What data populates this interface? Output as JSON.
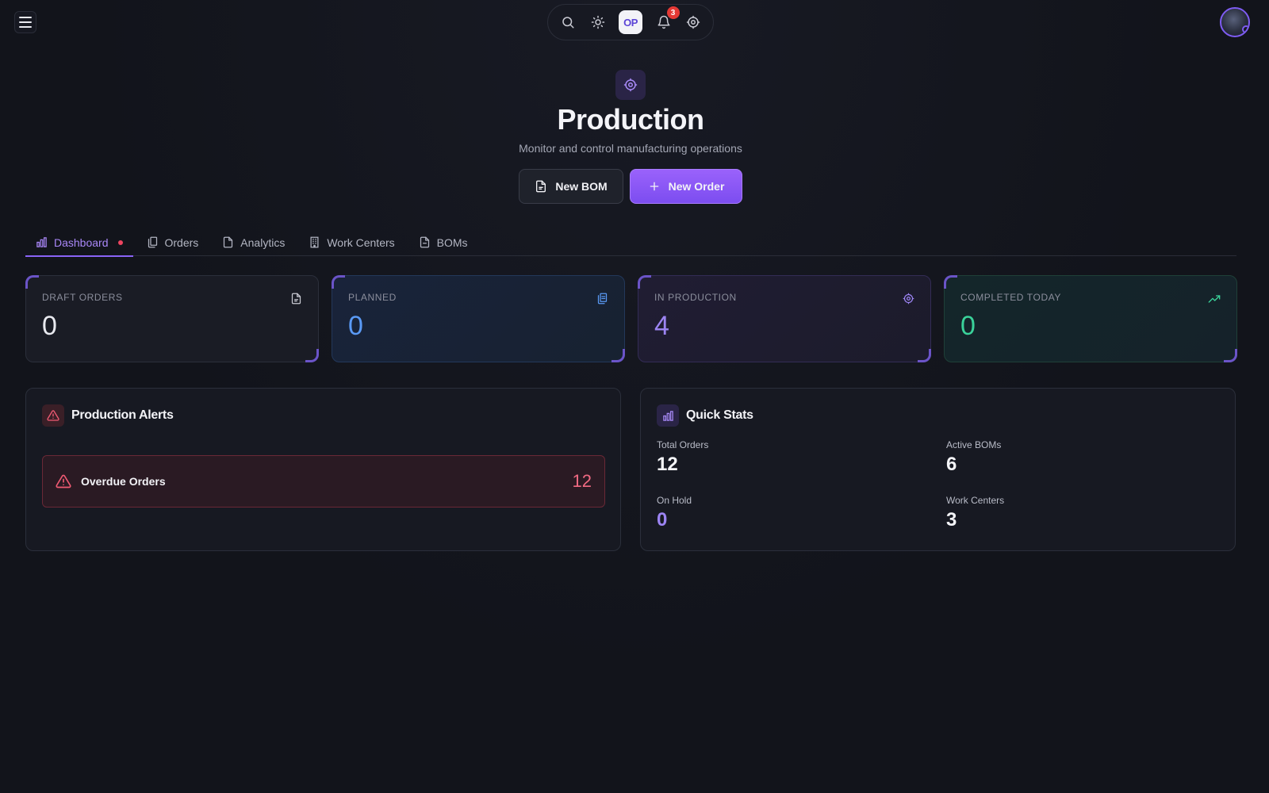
{
  "toolbar": {
    "logo_text": "OP",
    "notification_count": "3",
    "icons": [
      "search-icon",
      "sun-icon",
      "bell-icon",
      "gear-icon"
    ]
  },
  "header": {
    "title": "Production",
    "subtitle": "Monitor and control manufacturing operations",
    "new_bom_label": "New BOM",
    "new_order_label": "New Order"
  },
  "tabs": [
    {
      "label": "Dashboard",
      "active": true,
      "icon": "bar-chart-icon"
    },
    {
      "label": "Orders",
      "icon": "clipboard-icon"
    },
    {
      "label": "Analytics",
      "icon": "file-icon"
    },
    {
      "label": "Work Centers",
      "icon": "building-icon"
    },
    {
      "label": "BOMs",
      "icon": "document-icon"
    }
  ],
  "stats": [
    {
      "label": "Draft Orders",
      "value": "0",
      "icon": "document-icon",
      "color": "#e8e9ef"
    },
    {
      "label": "Planned",
      "value": "0",
      "icon": "clipboard-icon",
      "color": "#5a9af5"
    },
    {
      "label": "In Production",
      "value": "4",
      "icon": "gear-icon",
      "color": "#9c84f3"
    },
    {
      "label": "Completed Today",
      "value": "0",
      "icon": "trending-up-icon",
      "color": "#3ad29a"
    }
  ],
  "alerts": {
    "title": "Production Alerts",
    "items": [
      {
        "label": "Overdue Orders",
        "count": "12"
      }
    ]
  },
  "quick_stats": {
    "title": "Quick Stats",
    "items": [
      {
        "label": "Total Orders",
        "value": "12"
      },
      {
        "label": "Active BOMs",
        "value": "6"
      },
      {
        "label": "On Hold",
        "value": "0"
      },
      {
        "label": "Work Centers",
        "value": "3"
      }
    ]
  },
  "colors": {
    "accent": "#8a63f6",
    "background": "#12141b",
    "alert": "#f05a73"
  }
}
